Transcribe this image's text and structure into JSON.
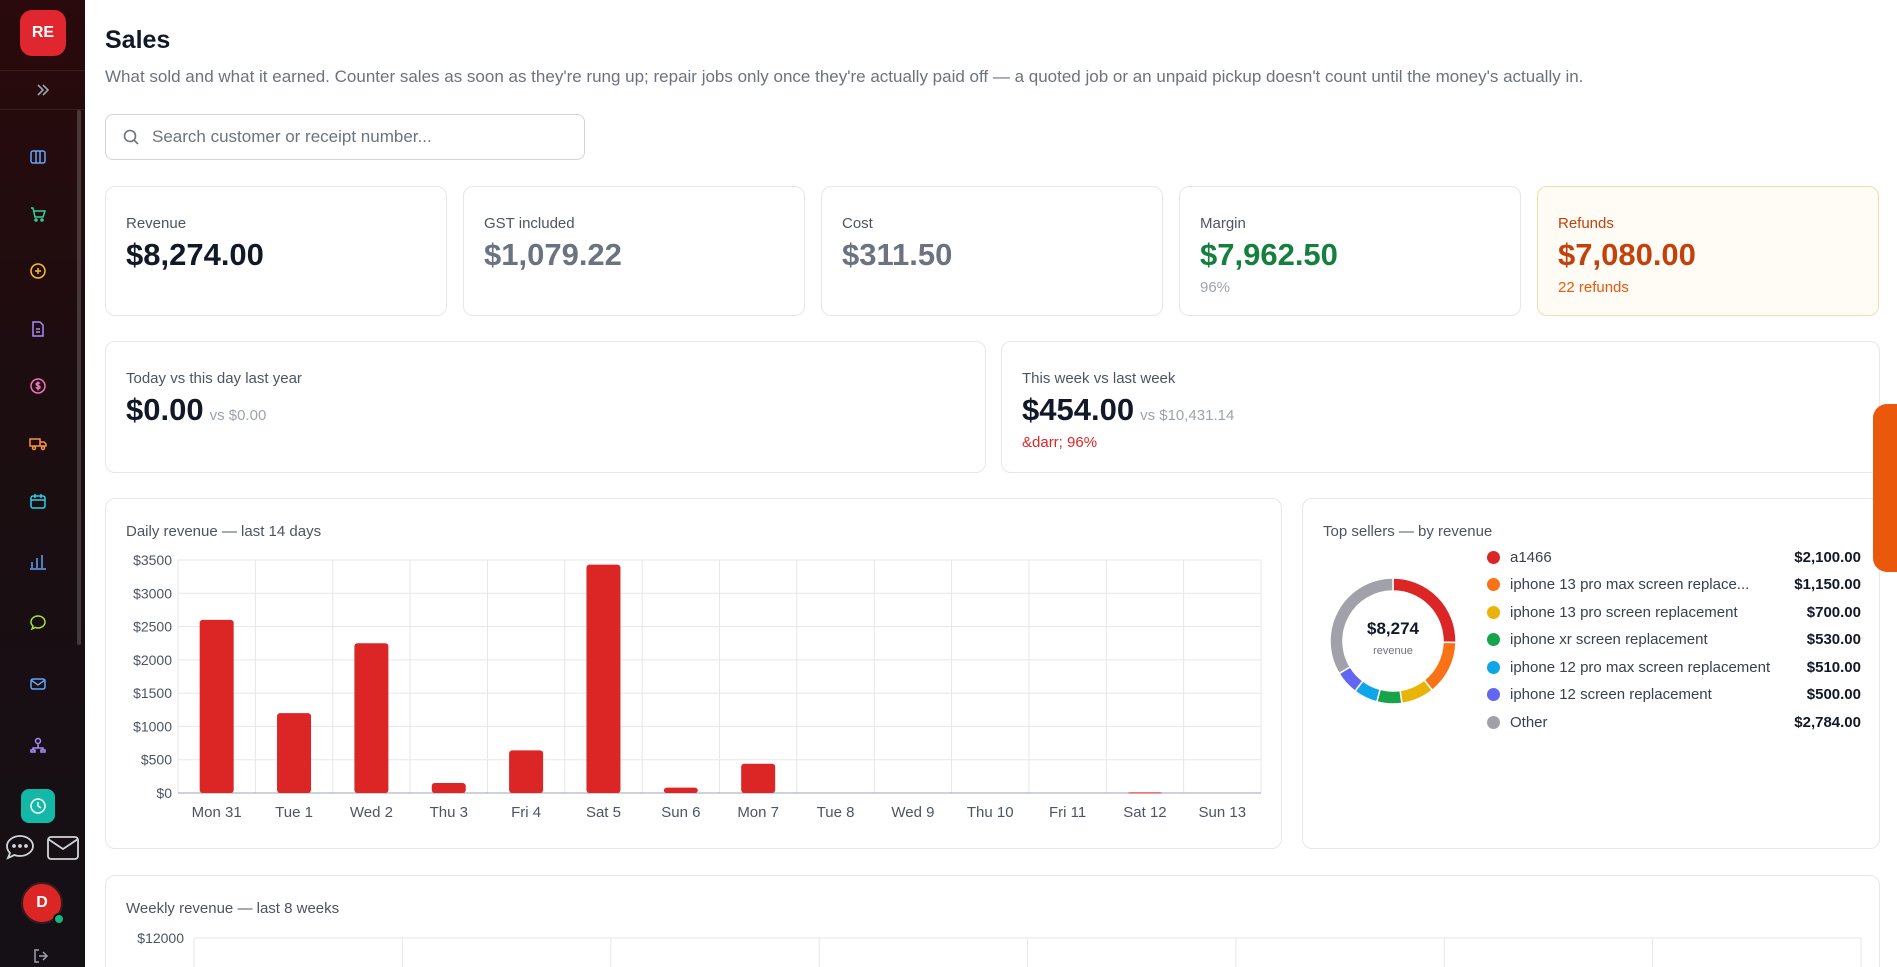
{
  "app": {
    "logo_text": "RE",
    "avatar_initial": "D"
  },
  "sidebar": {
    "items": [
      {
        "icon": "columns-icon",
        "color": "#60a5fa"
      },
      {
        "icon": "cart-icon",
        "color": "#34d399"
      },
      {
        "icon": "plus-circle-icon",
        "color": "#fbbf24"
      },
      {
        "icon": "document-icon",
        "color": "#a78bfa"
      },
      {
        "icon": "dollar-icon",
        "color": "#f472b6"
      },
      {
        "icon": "truck-icon",
        "color": "#fb923c"
      },
      {
        "icon": "calendar-icon",
        "color": "#22d3ee"
      },
      {
        "icon": "bar-chart-icon",
        "color": "#60a5fa"
      },
      {
        "icon": "chat-icon",
        "color": "#a3e635"
      },
      {
        "icon": "mail-icon",
        "color": "#60a5fa"
      },
      {
        "icon": "org-chart-icon",
        "color": "#a78bfa"
      },
      {
        "icon": "clock-icon",
        "color": "#ffffff"
      }
    ]
  },
  "header": {
    "title": "Sales",
    "description": "What sold and what it earned. Counter sales as soon as they're rung up; repair jobs only once they're actually paid off — a quoted job or an unpaid pickup doesn't count until the money's actually in."
  },
  "search": {
    "placeholder": "Search customer or receipt number..."
  },
  "stats": {
    "revenue": {
      "label": "Revenue",
      "value": "$8,274.00"
    },
    "gst": {
      "label": "GST included",
      "value": "$1,079.22"
    },
    "cost": {
      "label": "Cost",
      "value": "$311.50"
    },
    "margin": {
      "label": "Margin",
      "value": "$7,962.50",
      "sub": "96%"
    },
    "refunds": {
      "label": "Refunds",
      "value": "$7,080.00",
      "sub": "22 refunds"
    }
  },
  "comparisons": {
    "today": {
      "label": "Today vs this day last year",
      "value": "$0.00",
      "vs": "vs $0.00"
    },
    "week": {
      "label": "This week vs last week",
      "value": "$454.00",
      "vs": "vs $10,431.14",
      "change": "&darr; 96%"
    }
  },
  "colors": {
    "accent": "#dc2626",
    "margin_green": "#15803d",
    "refund_orange": "#c2410c",
    "down_red": "#dc2626"
  },
  "chart_data": [
    {
      "type": "bar",
      "title": "Daily revenue — last 14 days",
      "categories": [
        "Mon 31",
        "Tue 1",
        "Wed 2",
        "Thu 3",
        "Fri 4",
        "Sat 5",
        "Sun 6",
        "Mon 7",
        "Tue 8",
        "Wed 9",
        "Thu 10",
        "Fri 11",
        "Sat 12",
        "Sun 13"
      ],
      "values": [
        2600,
        1200,
        2250,
        150,
        640,
        3430,
        80,
        440,
        0,
        0,
        0,
        0,
        10,
        0
      ],
      "yticks": [
        "$0",
        "$500",
        "$1000",
        "$1500",
        "$2000",
        "$2500",
        "$3000",
        "$3500"
      ],
      "ylim": [
        0,
        3500
      ],
      "grid": true,
      "color": "#dc2626"
    },
    {
      "type": "pie",
      "title": "Top sellers — by revenue",
      "center_value": "$8,274",
      "center_label": "revenue",
      "slices": [
        {
          "name": "a1466",
          "value": 2100,
          "label": "$2,100.00",
          "color": "#dc2626"
        },
        {
          "name": "iphone 13 pro max screen replace...",
          "value": 1150,
          "label": "$1,150.00",
          "color": "#f97316"
        },
        {
          "name": "iphone 13 pro screen replacement",
          "value": 700,
          "label": "$700.00",
          "color": "#eab308"
        },
        {
          "name": "iphone xr screen replacement",
          "value": 530,
          "label": "$530.00",
          "color": "#16a34a"
        },
        {
          "name": "iphone 12 pro max screen replacement",
          "value": 510,
          "label": "$510.00",
          "color": "#0ea5e9"
        },
        {
          "name": "iphone 12 screen replacement",
          "value": 500,
          "label": "$500.00",
          "color": "#6366f1"
        },
        {
          "name": "Other",
          "value": 2784,
          "label": "$2,784.00",
          "color": "#a1a1aa"
        }
      ]
    },
    {
      "type": "bar",
      "title": "Weekly revenue — last 8 weeks",
      "yticks": [
        "$12000"
      ],
      "ylim": [
        0,
        12000
      ],
      "grid": true
    }
  ]
}
